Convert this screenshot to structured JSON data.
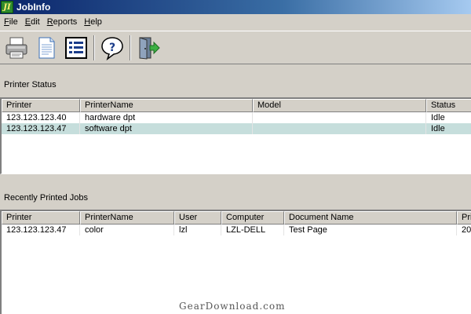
{
  "window": {
    "title": "JobInfo",
    "icon_text": "JI"
  },
  "menu": [
    "File",
    "Edit",
    "Reports",
    "Help"
  ],
  "toolbar": {
    "icons": [
      "printer-icon",
      "document-icon",
      "list-icon",
      "help-icon",
      "exit-icon"
    ]
  },
  "printer_status": {
    "label": "Printer Status",
    "columns": [
      "Printer",
      "PrinterName",
      "Model",
      "Status"
    ],
    "rows": [
      [
        "123.123.123.40",
        "hardware dpt",
        "",
        "Idle"
      ],
      [
        "123.123.123.47",
        "software dpt",
        "",
        "Idle"
      ]
    ],
    "selected_row": 1
  },
  "recent_jobs": {
    "label": "Recently Printed Jobs",
    "columns": [
      "Printer",
      "PrinterName",
      "User",
      "Computer",
      "Document Name",
      "Pri"
    ],
    "rows": [
      [
        "123.123.123.47",
        "color",
        "lzl",
        "LZL-DELL",
        "Test Page",
        "20"
      ]
    ]
  },
  "watermark": "GearDownload.com",
  "colors": {
    "selected_row": "#c6dedc",
    "titlebar": "#0a246a"
  }
}
